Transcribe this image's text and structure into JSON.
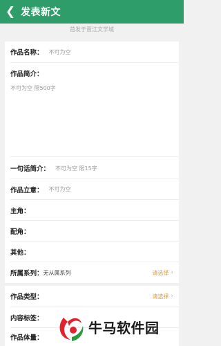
{
  "header": {
    "back_icon": "chevron-left-icon",
    "title": "发表新文"
  },
  "subtitle": "首发于晋江文学城",
  "form": {
    "work_name": {
      "label": "作品名称：",
      "placeholder": "不可为空"
    },
    "intro": {
      "label": "作品简介：",
      "placeholder": "不可为空 限500字"
    },
    "one_line_intro": {
      "label": "一句话简介：",
      "placeholder": "不可为空 限15字"
    },
    "theme": {
      "label": "作品立意：",
      "placeholder": "不可为空"
    },
    "protagonist": {
      "label": "主角："
    },
    "supporting": {
      "label": "配角："
    },
    "others": {
      "label": "其他："
    },
    "series": {
      "label": "所属系列：",
      "value": "无从属系列",
      "action": "请选择"
    },
    "work_type": {
      "label": "作品类型：",
      "action": "请选择"
    },
    "content_tags": {
      "label": "内容标签："
    },
    "work_size": {
      "label": "作品体量："
    }
  },
  "watermark": {
    "text": "牛马软件园"
  },
  "colors": {
    "header": "#2f9d6a",
    "action": "#d89a3f",
    "background": "#f1f1f1"
  }
}
